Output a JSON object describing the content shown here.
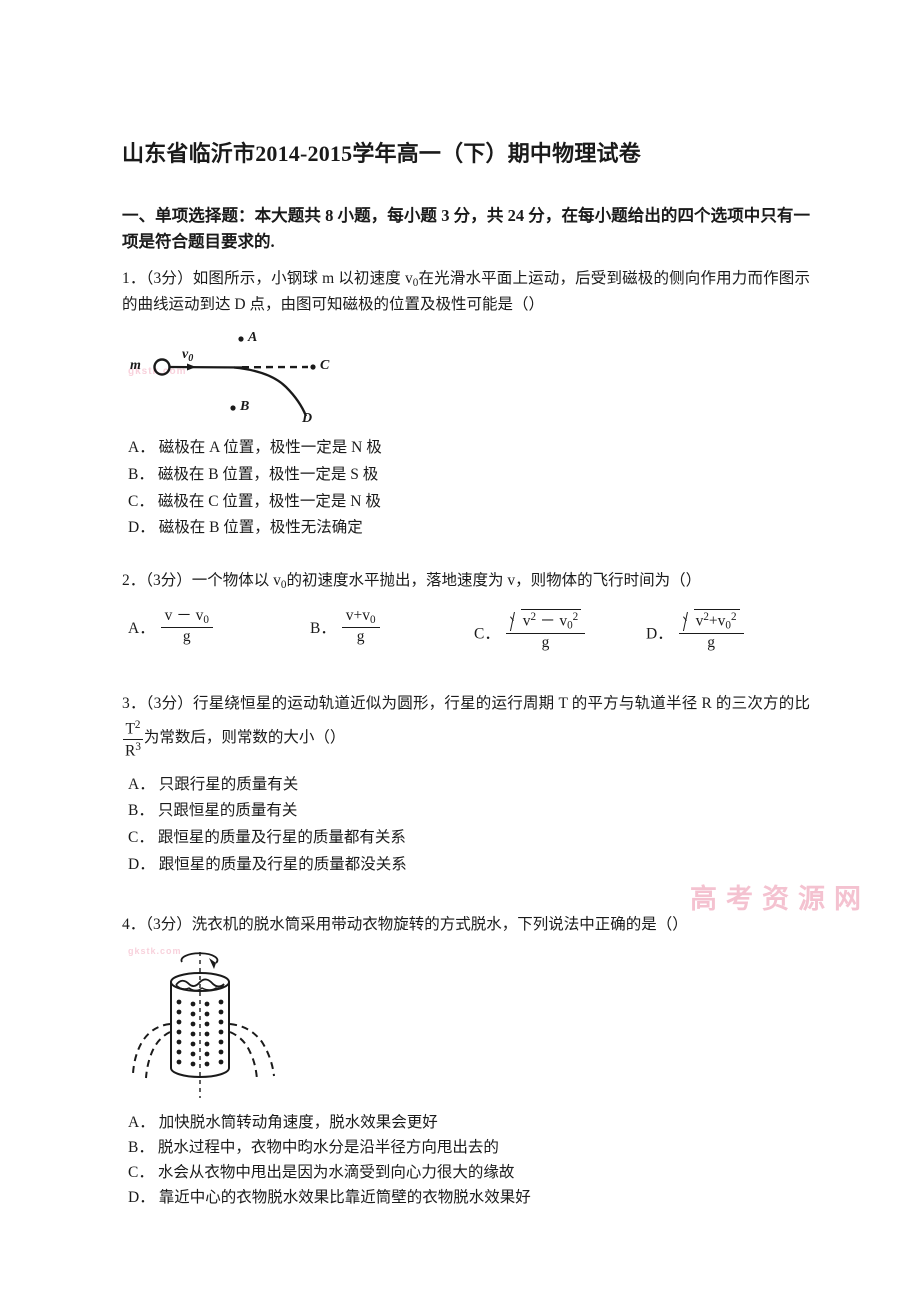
{
  "document": {
    "title": "山东省临沂市2014-2015学年高一（下）期中物理试卷",
    "watermark": "高考资源网",
    "watermark_small": "gkstk.com"
  },
  "section": {
    "heading": "一、单项选择题：本大题共 8 小题，每小题 3 分，共 24 分，在每小题给出的四个选项中只有一项是符合题目要求的."
  },
  "questions": [
    {
      "number": "1",
      "score": "（3分）",
      "stem": "如图所示，小钢球 m 以初速度 v",
      "stem_sub": "0",
      "stem_rest": "在光滑水平面上运动，后受到磁极的侧向作用力而作图示的曲线运动到达 D 点，由图可知磁极的位置及极性可能是（）",
      "figure": {
        "name": "curved-trajectory-diagram",
        "mass_label": "m",
        "velocity_label": "v",
        "velocity_sub": "0",
        "point_a": "A",
        "point_b": "B",
        "point_c": "C",
        "point_d": "D"
      },
      "options": [
        {
          "label": "A．",
          "text": "磁极在 A 位置，极性一定是 N 极"
        },
        {
          "label": "B．",
          "text": "磁极在 B 位置，极性一定是 S 极"
        },
        {
          "label": "C．",
          "text": "磁极在 C 位置，极性一定是 N 极"
        },
        {
          "label": "D．",
          "text": "磁极在 B 位置，极性无法确定"
        }
      ]
    },
    {
      "number": "2",
      "score": "（3分）",
      "stem_pre": "一个物体以 v",
      "stem_sub": "0",
      "stem_post": "的初速度水平抛出，落地速度为 v，则物体的飞行时间为（）",
      "formula_options": [
        {
          "label": "A．",
          "num_left": "v",
          "num_op": "－",
          "num_right": "v",
          "num_right_sub": "0",
          "den": "g",
          "radical": false
        },
        {
          "label": "B．",
          "num_left": "v",
          "num_op": "+",
          "num_right": "v",
          "num_right_sub": "0",
          "den": "g",
          "radical": false
        },
        {
          "label": "C．",
          "num_left": "v",
          "num_left_sup": "2",
          "num_op": "－",
          "num_right": "v",
          "num_right_sub": "0",
          "num_right_sup": "2",
          "den": "g",
          "radical": true
        },
        {
          "label": "D．",
          "num_left": "v",
          "num_left_sup": "2",
          "num_op": "+",
          "num_right": "v",
          "num_right_sub": "0",
          "num_right_sup": "2",
          "den": "g",
          "radical": true
        }
      ]
    },
    {
      "number": "3",
      "score": "（3分）",
      "stem_pre": "行星绕恒星的运动轨道近似为圆形，行星的运行周期 T 的平方与轨道半径 R 的三次方的比",
      "frac_num": "T",
      "frac_num_sup": "2",
      "frac_den": "R",
      "frac_den_sup": "3",
      "stem_post": "为常数后，则常数的大小（）",
      "options": [
        {
          "label": "A．",
          "text": "只跟行星的质量有关"
        },
        {
          "label": "B．",
          "text": "只跟恒星的质量有关"
        },
        {
          "label": "C．",
          "text": "跟恒星的质量及行星的质量都有关系"
        },
        {
          "label": "D．",
          "text": "跟恒星的质量及行星的质量都没关系"
        }
      ]
    },
    {
      "number": "4",
      "score": "（3分）",
      "stem": "洗衣机的脱水筒采用带动衣物旋转的方式脱水，下列说法中正确的是（）",
      "figure": {
        "name": "washing-machine-spin-drum-diagram"
      },
      "options": [
        {
          "label": "A．",
          "text": "加快脱水筒转动角速度，脱水效果会更好"
        },
        {
          "label": "B．",
          "text": "脱水过程中，衣物中昀水分是沿半径方向甩出去的"
        },
        {
          "label": "C．",
          "text": "水会从衣物中甩出是因为水滴受到向心力很大的缘故"
        },
        {
          "label": "D．",
          "text": "靠近中心的衣物脱水效果比靠近筒壁的衣物脱水效果好"
        }
      ]
    }
  ]
}
